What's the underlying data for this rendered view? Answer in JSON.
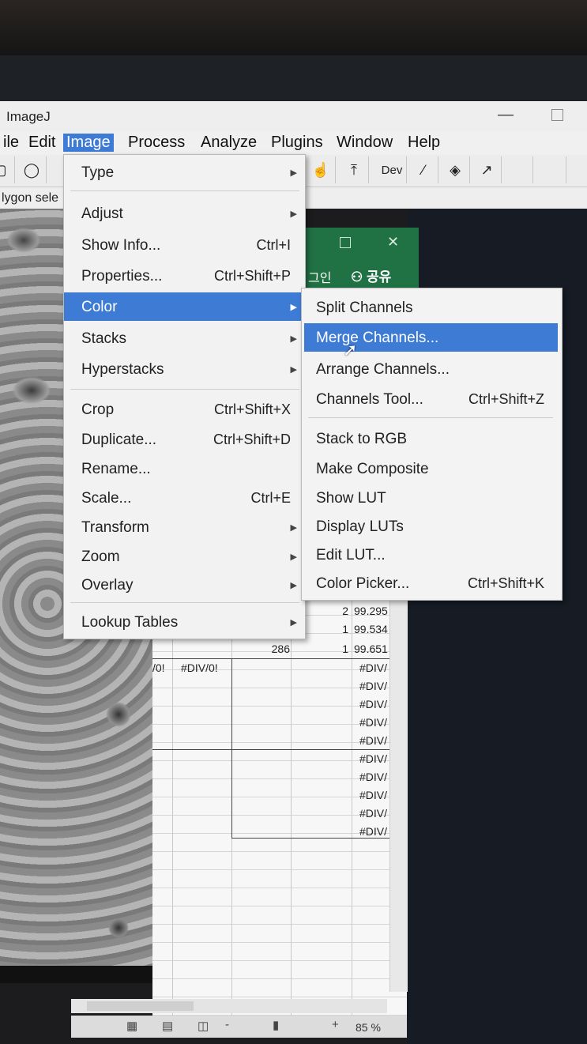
{
  "window": {
    "title": "ImageJ",
    "minimize": "—"
  },
  "menubar": [
    "ile",
    "Edit",
    "Image",
    "Process",
    "Analyze",
    "Plugins",
    "Window",
    "Help"
  ],
  "toolbar": {
    "dev_label": "Dev"
  },
  "status_text": "lygon sele",
  "image_menu": {
    "items": [
      {
        "label": "Type",
        "shortcut": "",
        "submenu": true
      },
      {
        "label": "Adjust",
        "shortcut": "",
        "submenu": true
      },
      {
        "label": "Show Info...",
        "shortcut": "Ctrl+I",
        "submenu": false
      },
      {
        "label": "Properties...",
        "shortcut": "Ctrl+Shift+P",
        "submenu": false
      },
      {
        "label": "Color",
        "shortcut": "",
        "submenu": true
      },
      {
        "label": "Stacks",
        "shortcut": "",
        "submenu": true
      },
      {
        "label": "Hyperstacks",
        "shortcut": "",
        "submenu": true
      },
      {
        "label": "Crop",
        "shortcut": "Ctrl+Shift+X",
        "submenu": false
      },
      {
        "label": "Duplicate...",
        "shortcut": "Ctrl+Shift+D",
        "submenu": false
      },
      {
        "label": "Rename...",
        "shortcut": "",
        "submenu": false
      },
      {
        "label": "Scale...",
        "shortcut": "Ctrl+E",
        "submenu": false
      },
      {
        "label": "Transform",
        "shortcut": "",
        "submenu": true
      },
      {
        "label": "Zoom",
        "shortcut": "",
        "submenu": true
      },
      {
        "label": "Overlay",
        "shortcut": "",
        "submenu": true
      },
      {
        "label": "Lookup Tables",
        "shortcut": "",
        "submenu": true
      }
    ]
  },
  "color_menu": {
    "items": [
      {
        "label": "Split Channels",
        "shortcut": ""
      },
      {
        "label": "Merge Channels...",
        "shortcut": ""
      },
      {
        "label": "Arrange Channels...",
        "shortcut": ""
      },
      {
        "label": "Channels Tool...",
        "shortcut": "Ctrl+Shift+Z"
      },
      {
        "label": "Stack to RGB",
        "shortcut": ""
      },
      {
        "label": "Make Composite",
        "shortcut": ""
      },
      {
        "label": "Show LUT",
        "shortcut": ""
      },
      {
        "label": "Display LUTs",
        "shortcut": ""
      },
      {
        "label": "Edit LUT...",
        "shortcut": ""
      },
      {
        "label": "Color Picker...",
        "shortcut": "Ctrl+Shift+K"
      }
    ]
  },
  "excel": {
    "login": "그인",
    "share": "공유",
    "share_icon": "person-icon",
    "rows": [
      {
        "a": "",
        "b": "",
        "c": "",
        "d": "2",
        "e": "99.295"
      },
      {
        "a": "",
        "b": "",
        "c": "",
        "d": "1",
        "e": "99.534"
      },
      {
        "a": "",
        "b": "",
        "c": "286",
        "d": "1",
        "e": "99.651"
      }
    ],
    "div_left": "/0!",
    "div_mid": "#DIV/0!",
    "div_col": [
      "#DIV/",
      "#DIV/",
      "#DIV/",
      "#DIV/",
      "#DIV/",
      "#DIV/",
      "#DIV/",
      "#DIV/",
      "#DIV/",
      "#DIV/"
    ],
    "zoom": "85 %",
    "zoom_minus": "-",
    "zoom_plus": "+"
  },
  "colors": {
    "highlight": "#3e7bd5",
    "excel_green": "#207245"
  }
}
